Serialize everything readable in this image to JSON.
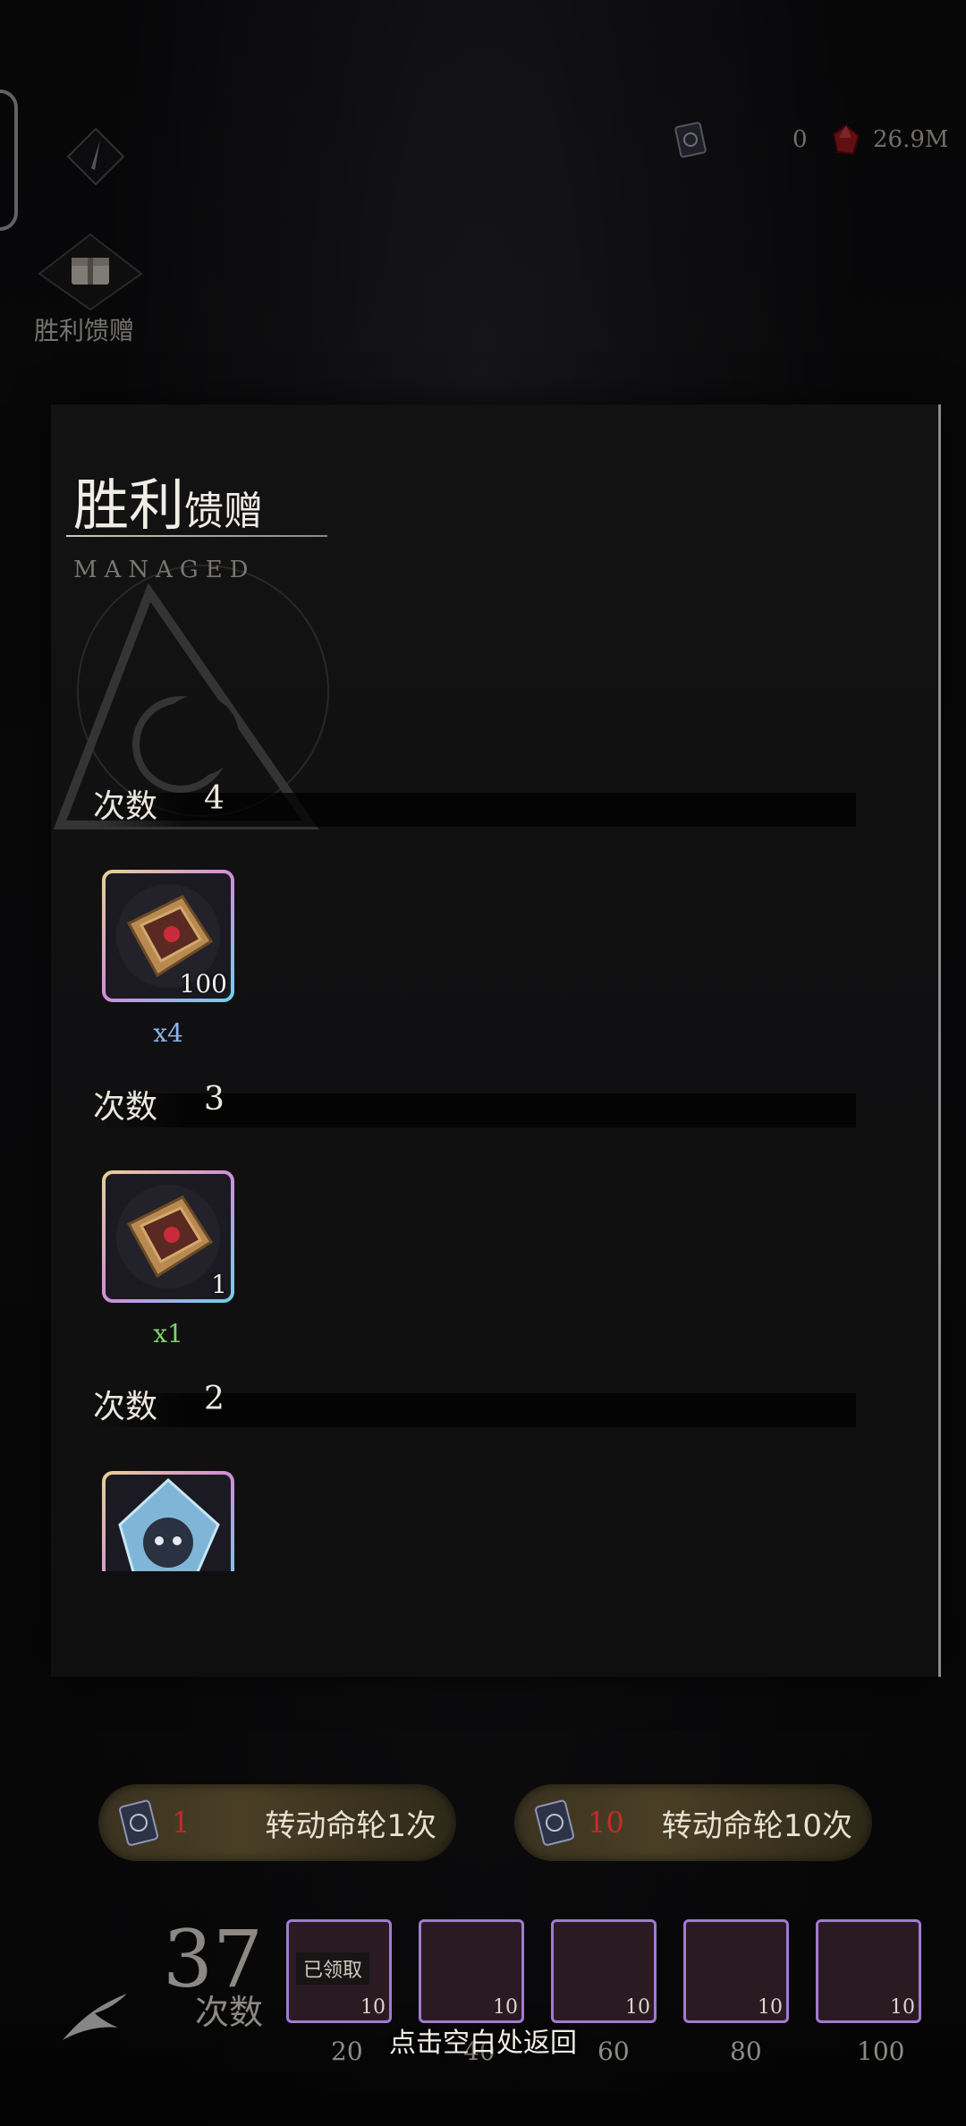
{
  "currency": [
    {
      "icon": "tarot-book-icon",
      "value": "0"
    },
    {
      "icon": "red-crystal-icon",
      "value": "26.9M"
    }
  ],
  "nav": {
    "gift_label": "胜利馈赠"
  },
  "modal": {
    "title_big": "胜利",
    "title_small": "馈赠",
    "subtitle": "MANAGED",
    "sections": [
      {
        "label": "次数",
        "count": "4",
        "item": {
          "icon": "ornate-chest-icon",
          "qty": "100",
          "multiplier": "x4",
          "mult_color": "#8fb2ea"
        }
      },
      {
        "label": "次数",
        "count": "3",
        "item": {
          "icon": "ornate-chest-icon",
          "qty": "1",
          "multiplier": "x1",
          "mult_color": "#7fd36a"
        }
      },
      {
        "label": "次数",
        "count": "2",
        "item": {
          "icon": "character-crystal-icon",
          "qty": "",
          "multiplier": "",
          "mult_color": "#8fb2ea"
        }
      }
    ]
  },
  "spin_buttons": [
    {
      "count": "1",
      "label": "转动命轮1次"
    },
    {
      "count": "10",
      "label": "转动命轮10次"
    }
  ],
  "progress": {
    "count": "37",
    "label": "次数",
    "rewards": [
      {
        "qty": "10",
        "milestone": "20",
        "claimed": "已领取"
      },
      {
        "qty": "10",
        "milestone": "40",
        "claimed": ""
      },
      {
        "qty": "10",
        "milestone": "60",
        "claimed": ""
      },
      {
        "qty": "10",
        "milestone": "80",
        "claimed": ""
      },
      {
        "qty": "10",
        "milestone": "100",
        "claimed": ""
      }
    ]
  },
  "footer_hint": "点击空白处返回",
  "colors": {
    "accent_red": "#c42a2a",
    "frame_purple": "#a07bd0",
    "frame_gold": "#e0c98f"
  }
}
